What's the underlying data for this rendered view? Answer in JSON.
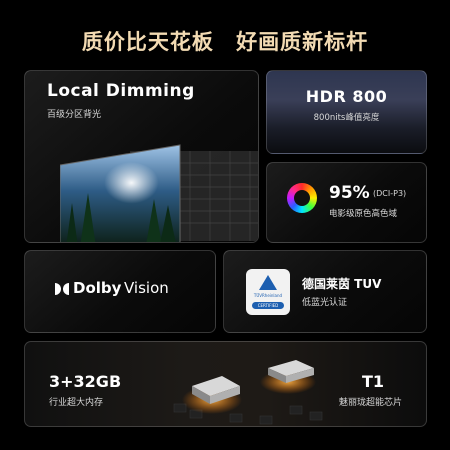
{
  "headline": {
    "left": "质价比天花板",
    "right": "好画质新标杆"
  },
  "local_dimming": {
    "title": "Local Dimming",
    "subtitle": "百级分区背光"
  },
  "hdr": {
    "title": "HDR 800",
    "subtitle": "800nits峰值亮度"
  },
  "color_gamut": {
    "percent": "95%",
    "standard": "(DCI-P3)",
    "subtitle": "电影级原色高色域"
  },
  "dolby": {
    "brand": "Dolby",
    "product": "Vision"
  },
  "tuv": {
    "title": "德国莱茵 TUV",
    "subtitle": "低蓝光认证",
    "badge_brand": "TÜVRheinland",
    "badge_certified": "CERTIFIED"
  },
  "memory": {
    "value": "3+32GB",
    "subtitle": "行业超大内存"
  },
  "chip": {
    "name": "T1",
    "subtitle": "魅丽珑超能芯片"
  },
  "colors": {
    "accent_gold": "#f3dbb3",
    "background": "#000000",
    "tuv_blue": "#1d5fb0"
  }
}
